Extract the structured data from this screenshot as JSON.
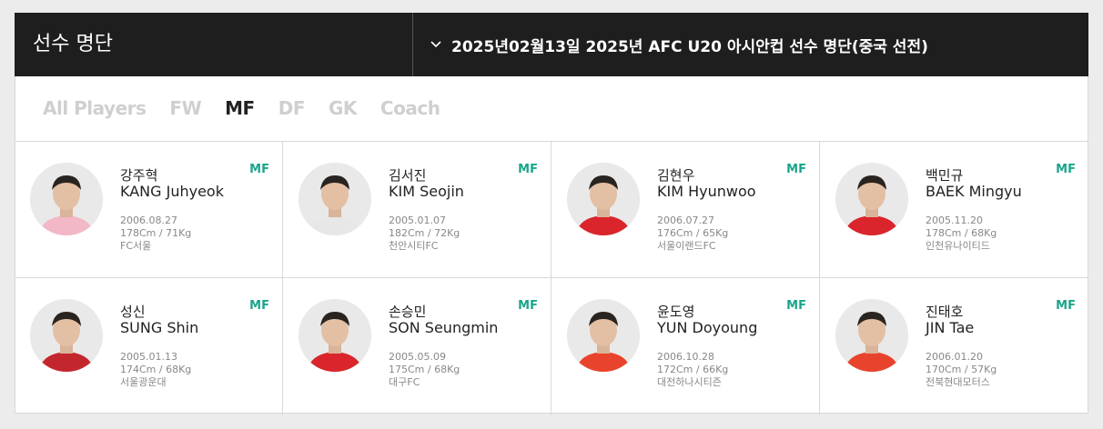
{
  "header": {
    "title": "선수 명단",
    "selected_roster": "2025년02월13일 2025년 AFC U20 아시안컵 선수 명단(중국 선전)"
  },
  "tabs": [
    {
      "label": "All Players",
      "active": false
    },
    {
      "label": "FW",
      "active": false
    },
    {
      "label": "MF",
      "active": true
    },
    {
      "label": "DF",
      "active": false
    },
    {
      "label": "GK",
      "active": false
    },
    {
      "label": "Coach",
      "active": false
    }
  ],
  "players": [
    {
      "name_ko": "강주혁",
      "name_en": "KANG Juhyeok",
      "position": "MF",
      "birth": "2006.08.27",
      "body": "178Cm / 71Kg",
      "club": "FC서울",
      "kit_color": "#f2b8c6"
    },
    {
      "name_ko": "김서진",
      "name_en": "KIM Seojin",
      "position": "MF",
      "birth": "2005.01.07",
      "body": "182Cm / 72Kg",
      "club": "천안시티FC",
      "kit_color": "#e7e7e7"
    },
    {
      "name_ko": "김현우",
      "name_en": "KIM Hyunwoo",
      "position": "MF",
      "birth": "2006.07.27",
      "body": "176Cm / 65Kg",
      "club": "서울이랜드FC",
      "kit_color": "#d9252b"
    },
    {
      "name_ko": "백민규",
      "name_en": "BAEK Mingyu",
      "position": "MF",
      "birth": "2005.11.20",
      "body": "178Cm / 68Kg",
      "club": "인천유나이티드",
      "kit_color": "#d9252b"
    },
    {
      "name_ko": "성신",
      "name_en": "SUNG Shin",
      "position": "MF",
      "birth": "2005.01.13",
      "body": "174Cm / 68Kg",
      "club": "서울광운대",
      "kit_color": "#c4262d"
    },
    {
      "name_ko": "손승민",
      "name_en": "SON Seungmin",
      "position": "MF",
      "birth": "2005.05.09",
      "body": "175Cm / 68Kg",
      "club": "대구FC",
      "kit_color": "#d9252b"
    },
    {
      "name_ko": "윤도영",
      "name_en": "YUN Doyoung",
      "position": "MF",
      "birth": "2006.10.28",
      "body": "172Cm / 66Kg",
      "club": "대전하나시티즌",
      "kit_color": "#e8432c"
    },
    {
      "name_ko": "진태호",
      "name_en": "JIN Tae",
      "position": "MF",
      "birth": "2006.01.20",
      "body": "170Cm / 57Kg",
      "club": "전북현대모터스",
      "kit_color": "#e8432c"
    }
  ]
}
